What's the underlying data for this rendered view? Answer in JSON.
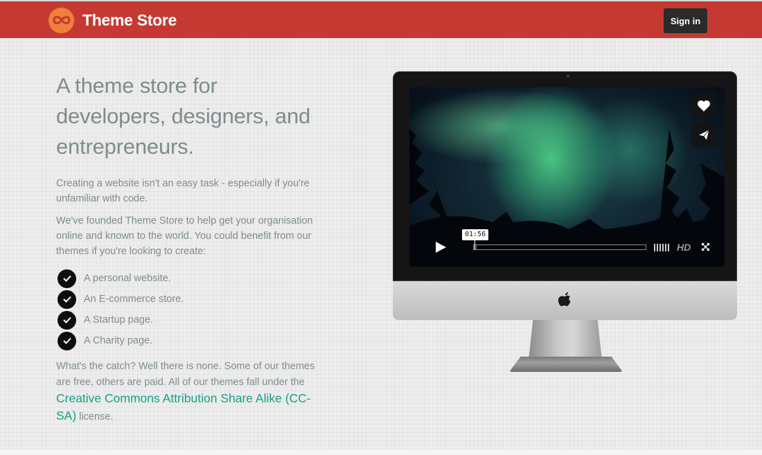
{
  "header": {
    "brand_name": "Theme Store",
    "logo_icon": "infinity-icon",
    "signin_label": "Sign in",
    "colors": {
      "navbar": "#c43a33",
      "logo": "#f07f3a",
      "signin_bg": "#2b2b2b"
    }
  },
  "hero": {
    "headline": "A theme store for developers, designers, and entrepreneurs.",
    "paragraph1": "Creating a website isn't an easy task - especially if you're unfamiliar with code.",
    "paragraph2": "We've founded Theme Store to help get your organisation online and known to the world. You could benefit from our themes if you're looking to create:",
    "checklist": [
      "A personal website.",
      "An E-commerce store.",
      "A Startup page.",
      "A Charity page."
    ],
    "catch_text_before": "What's the catch? Well there is none. Some of our themes are free, others are paid. All of our themes fall under the",
    "license_link": "Creative Commons Attribution Share Alike (CC-SA)",
    "catch_text_after": "license.",
    "colors": {
      "text": "#7f8c8d",
      "link": "#16a085"
    }
  },
  "video": {
    "time_display": "01:56",
    "progress": 0.02,
    "hd_label": "HD",
    "icons": [
      "heart-icon",
      "send-icon",
      "play-icon",
      "volume-icon",
      "fullscreen-icon"
    ]
  }
}
